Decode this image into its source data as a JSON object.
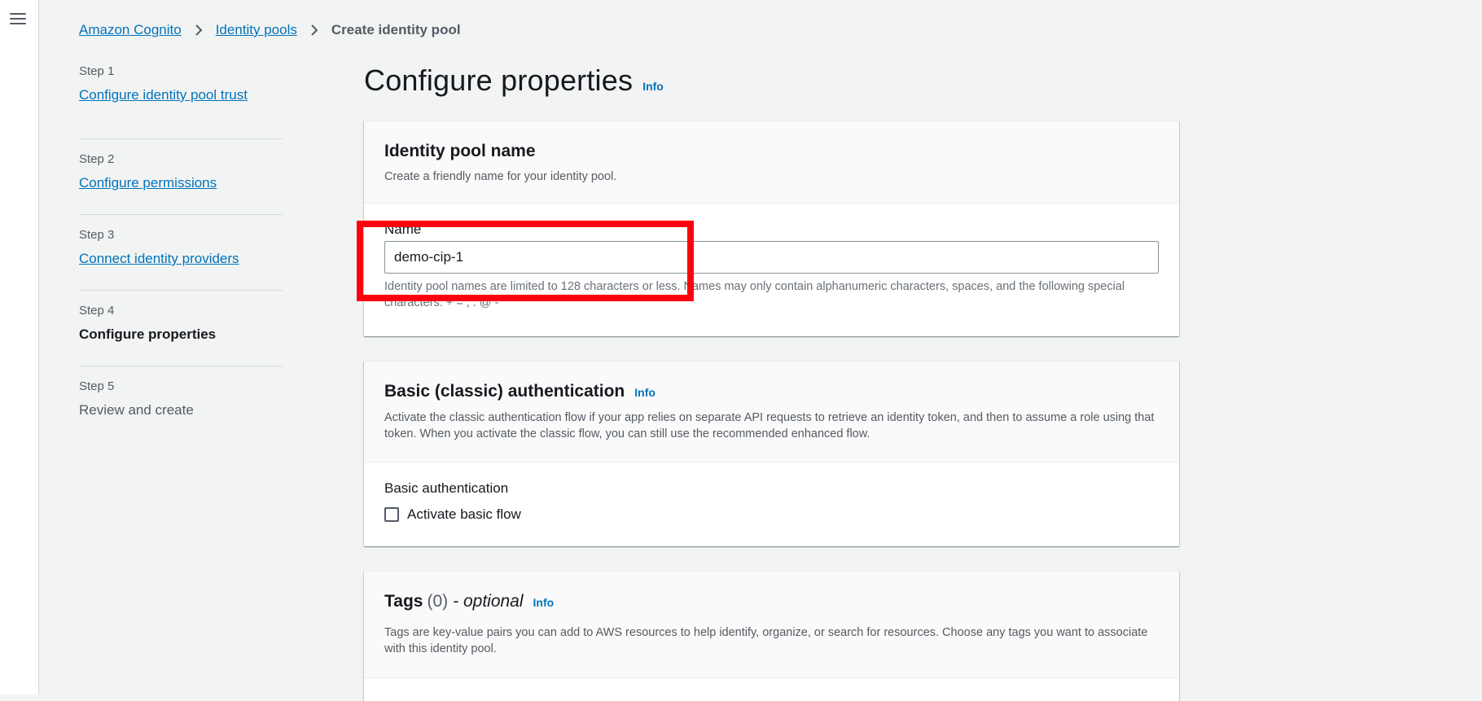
{
  "breadcrumb": {
    "items": [
      "Amazon Cognito",
      "Identity pools"
    ],
    "current": "Create identity pool"
  },
  "steps": [
    {
      "number": "Step 1",
      "title": "Configure identity pool trust",
      "state": "link"
    },
    {
      "number": "Step 2",
      "title": "Configure permissions",
      "state": "link"
    },
    {
      "number": "Step 3",
      "title": "Connect identity providers",
      "state": "link"
    },
    {
      "number": "Step 4",
      "title": "Configure properties",
      "state": "active"
    },
    {
      "number": "Step 5",
      "title": "Review and create",
      "state": "disabled"
    }
  ],
  "page": {
    "title": "Configure properties",
    "info": "Info"
  },
  "identity_pool_name": {
    "heading": "Identity pool name",
    "description": "Create a friendly name for your identity pool.",
    "field_label": "Name",
    "value": "demo-cip-1",
    "constraint": "Identity pool names are limited to 128 characters or less. Names may only contain alphanumeric characters, spaces, and the following special characters: + = , . @ -"
  },
  "basic_auth": {
    "heading": "Basic (classic) authentication",
    "info": "Info",
    "description": "Activate the classic authentication flow if your app relies on separate API requests to retrieve an identity token, and then to assume a role using that token. When you activate the classic flow, you can still use the recommended enhanced flow.",
    "section_label": "Basic authentication",
    "checkbox_label": "Activate basic flow",
    "checked": false
  },
  "tags": {
    "heading": "Tags",
    "count": "(0)",
    "optional": "- optional",
    "info": "Info",
    "description": "Tags are key-value pairs you can add to AWS resources to help identify, organize, or search for resources. Choose any tags you want to associate with this identity pool."
  },
  "colors": {
    "link": "#0073bb",
    "highlight": "#ff0010",
    "background": "#f2f3f3"
  }
}
